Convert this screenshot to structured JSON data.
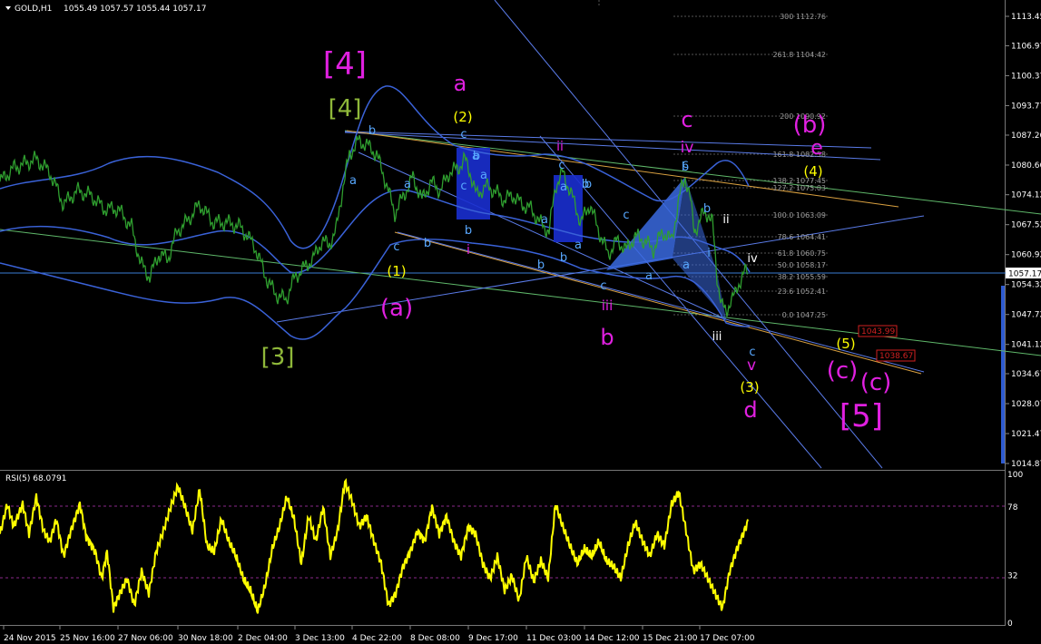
{
  "chart_data": {
    "type": "line",
    "header": {
      "symbol": "GOLD,H1",
      "ohlc": [
        "1055.49",
        "1057.57",
        "1055.44",
        "1057.17"
      ]
    },
    "price_axis": {
      "labels": [
        "1113.45",
        "1106.97",
        "1100.37",
        "1093.77",
        "1087.26",
        "1080.66",
        "1074.12",
        "1067.52",
        "1060.92",
        "1054.32",
        "1047.72",
        "1041.12",
        "1034.67",
        "1028.07",
        "1021.47",
        "1014.87"
      ],
      "current_price": "1057.17",
      "ylim": [
        1014.87,
        1113.45
      ]
    },
    "time_axis": {
      "labels": [
        "24 Nov 2015",
        "25 Nov 16:00",
        "27 Nov 06:00",
        "30 Nov 18:00",
        "2 Dec 04:00",
        "3 Dec 13:00",
        "4 Dec 22:00",
        "8 Dec 08:00",
        "9 Dec 17:00",
        "11 Dec 03:00",
        "14 Dec 12:00",
        "15 Dec 21:00",
        "17 Dec 07:00"
      ]
    },
    "price_series": {
      "name": "GOLD,H1",
      "color": "#2f9e2f",
      "anchors": [
        [
          0,
          1077
        ],
        [
          15,
          1080
        ],
        [
          40,
          1082
        ],
        [
          55,
          1079
        ],
        [
          70,
          1072
        ],
        [
          85,
          1075
        ],
        [
          100,
          1074
        ],
        [
          115,
          1071
        ],
        [
          130,
          1071
        ],
        [
          145,
          1067
        ],
        [
          155,
          1059
        ],
        [
          165,
          1056
        ],
        [
          175,
          1061
        ],
        [
          185,
          1060
        ],
        [
          195,
          1066
        ],
        [
          205,
          1068
        ],
        [
          220,
          1072
        ],
        [
          235,
          1068
        ],
        [
          250,
          1068
        ],
        [
          265,
          1067
        ],
        [
          280,
          1063
        ],
        [
          295,
          1055
        ],
        [
          305,
          1052
        ],
        [
          315,
          1051
        ],
        [
          325,
          1056
        ],
        [
          335,
          1058
        ],
        [
          345,
          1060
        ],
        [
          355,
          1064
        ],
        [
          362,
          1063
        ],
        [
          370,
          1066
        ],
        [
          378,
          1076
        ],
        [
          385,
          1083
        ],
        [
          395,
          1086
        ],
        [
          405,
          1085
        ],
        [
          415,
          1083
        ],
        [
          425,
          1077
        ],
        [
          435,
          1070
        ],
        [
          445,
          1074
        ],
        [
          455,
          1078
        ],
        [
          465,
          1073
        ],
        [
          475,
          1077
        ],
        [
          485,
          1075
        ],
        [
          495,
          1079
        ],
        [
          505,
          1080
        ],
        [
          512,
          1082
        ],
        [
          518,
          1079
        ],
        [
          525,
          1074
        ],
        [
          535,
          1076
        ],
        [
          545,
          1075
        ],
        [
          555,
          1073
        ],
        [
          565,
          1074
        ],
        [
          575,
          1072
        ],
        [
          585,
          1071
        ],
        [
          595,
          1068
        ],
        [
          605,
          1066
        ],
        [
          612,
          1076
        ],
        [
          620,
          1079
        ],
        [
          630,
          1074
        ],
        [
          640,
          1068
        ],
        [
          650,
          1072
        ],
        [
          660,
          1066
        ],
        [
          670,
          1061
        ],
        [
          680,
          1064
        ],
        [
          690,
          1062
        ],
        [
          700,
          1065
        ],
        [
          710,
          1064
        ],
        [
          720,
          1062
        ],
        [
          730,
          1066
        ],
        [
          740,
          1064
        ],
        [
          750,
          1075
        ],
        [
          755,
          1078
        ],
        [
          760,
          1074
        ],
        [
          765,
          1066
        ],
        [
          770,
          1068
        ],
        [
          775,
          1070
        ],
        [
          780,
          1070
        ],
        [
          785,
          1068
        ],
        [
          790,
          1056
        ],
        [
          795,
          1050
        ],
        [
          800,
          1048
        ],
        [
          805,
          1051
        ],
        [
          810,
          1052
        ],
        [
          815,
          1055
        ],
        [
          820,
          1057
        ],
        [
          824,
          1057
        ]
      ]
    },
    "rsi": {
      "label": "RSI(5) 68.0791",
      "color": "#ffff00",
      "levels": [
        78,
        32
      ],
      "axis_labels": [
        "100",
        "78",
        "32",
        "0"
      ],
      "anchors": [
        [
          0,
          60
        ],
        [
          8,
          80
        ],
        [
          15,
          65
        ],
        [
          25,
          80
        ],
        [
          32,
          60
        ],
        [
          40,
          85
        ],
        [
          48,
          62
        ],
        [
          55,
          55
        ],
        [
          62,
          70
        ],
        [
          70,
          45
        ],
        [
          78,
          62
        ],
        [
          88,
          80
        ],
        [
          95,
          58
        ],
        [
          105,
          48
        ],
        [
          112,
          30
        ],
        [
          118,
          48
        ],
        [
          125,
          10
        ],
        [
          132,
          20
        ],
        [
          140,
          30
        ],
        [
          148,
          12
        ],
        [
          156,
          35
        ],
        [
          164,
          20
        ],
        [
          172,
          48
        ],
        [
          180,
          62
        ],
        [
          188,
          78
        ],
        [
          196,
          92
        ],
        [
          204,
          78
        ],
        [
          212,
          62
        ],
        [
          220,
          90
        ],
        [
          228,
          52
        ],
        [
          236,
          48
        ],
        [
          244,
          70
        ],
        [
          252,
          55
        ],
        [
          260,
          45
        ],
        [
          268,
          30
        ],
        [
          276,
          22
        ],
        [
          284,
          8
        ],
        [
          292,
          25
        ],
        [
          300,
          50
        ],
        [
          308,
          65
        ],
        [
          316,
          85
        ],
        [
          324,
          70
        ],
        [
          332,
          40
        ],
        [
          340,
          72
        ],
        [
          348,
          55
        ],
        [
          356,
          78
        ],
        [
          364,
          45
        ],
        [
          372,
          62
        ],
        [
          380,
          95
        ],
        [
          388,
          82
        ],
        [
          396,
          65
        ],
        [
          404,
          72
        ],
        [
          412,
          55
        ],
        [
          420,
          40
        ],
        [
          428,
          12
        ],
        [
          436,
          20
        ],
        [
          444,
          38
        ],
        [
          452,
          48
        ],
        [
          460,
          62
        ],
        [
          468,
          55
        ],
        [
          476,
          78
        ],
        [
          484,
          60
        ],
        [
          492,
          72
        ],
        [
          500,
          55
        ],
        [
          508,
          45
        ],
        [
          516,
          65
        ],
        [
          524,
          60
        ],
        [
          532,
          40
        ],
        [
          540,
          30
        ],
        [
          548,
          45
        ],
        [
          556,
          22
        ],
        [
          564,
          32
        ],
        [
          572,
          15
        ],
        [
          580,
          45
        ],
        [
          588,
          28
        ],
        [
          596,
          42
        ],
        [
          604,
          30
        ],
        [
          612,
          80
        ],
        [
          620,
          65
        ],
        [
          628,
          52
        ],
        [
          636,
          40
        ],
        [
          644,
          50
        ],
        [
          652,
          45
        ],
        [
          660,
          55
        ],
        [
          668,
          42
        ],
        [
          676,
          38
        ],
        [
          684,
          30
        ],
        [
          692,
          52
        ],
        [
          700,
          68
        ],
        [
          708,
          55
        ],
        [
          716,
          45
        ],
        [
          724,
          60
        ],
        [
          732,
          52
        ],
        [
          740,
          80
        ],
        [
          748,
          88
        ],
        [
          756,
          62
        ],
        [
          764,
          35
        ],
        [
          772,
          40
        ],
        [
          780,
          30
        ],
        [
          788,
          20
        ],
        [
          796,
          10
        ],
        [
          804,
          35
        ],
        [
          812,
          50
        ],
        [
          820,
          62
        ],
        [
          824,
          68
        ]
      ]
    },
    "fibonacci": [
      {
        "ratio": "300",
        "price": "1112.76"
      },
      {
        "ratio": "261.8",
        "price": "1104.42"
      },
      {
        "ratio": "200",
        "price": "1090.92"
      },
      {
        "ratio": "161.8",
        "price": "1082.58"
      },
      {
        "ratio": "138.2",
        "price": "1077.45"
      },
      {
        "ratio": "127.2",
        "price": "1075.03"
      },
      {
        "ratio": "100.0",
        "price": "1063.09"
      },
      {
        "ratio": "78.6",
        "price": "1064.41"
      },
      {
        "ratio": "61.8",
        "price": "1060.75"
      },
      {
        "ratio": "50.0",
        "price": "1058.17"
      },
      {
        "ratio": "38.2",
        "price": "1055.59"
      },
      {
        "ratio": "23.6",
        "price": "1052.41"
      },
      {
        "ratio": "0.0",
        "price": "1047.25"
      }
    ],
    "price_tags": [
      "1043.99",
      "1038.67"
    ],
    "wave_labels": [
      {
        "text": "[4]",
        "color": "#e020e0"
      },
      {
        "text": "[4]",
        "color": "#8fb83a"
      },
      {
        "text": "[3]",
        "color": "#8fb83a"
      },
      {
        "text": "a",
        "color": "#e020e0"
      },
      {
        "text": "(2)",
        "color": "#ffff00"
      },
      {
        "text": "(1)",
        "color": "#ffff00"
      },
      {
        "text": "(a)",
        "color": "#e020e0"
      },
      {
        "text": "b",
        "color": "#e020e0"
      },
      {
        "text": "iii",
        "color": "#e020e0"
      },
      {
        "text": "c",
        "color": "#e020e0"
      },
      {
        "text": "iv",
        "color": "#e020e0"
      },
      {
        "text": "ii",
        "color": "#e020e0"
      },
      {
        "text": "i",
        "color": "#e020e0"
      },
      {
        "text": "(b)",
        "color": "#e020e0"
      },
      {
        "text": "e",
        "color": "#e020e0"
      },
      {
        "text": "(4)",
        "color": "#ffff00"
      },
      {
        "text": "(5)",
        "color": "#ffff00"
      },
      {
        "text": "(3)",
        "color": "#ffff00"
      },
      {
        "text": "d",
        "color": "#e020e0"
      },
      {
        "text": "v",
        "color": "#e020e0"
      },
      {
        "text": "(c)",
        "color": "#e020e0"
      },
      {
        "text": "(c)",
        "color": "#e020e0"
      },
      {
        "text": "[5]",
        "color": "#e020e0"
      },
      {
        "text": "ii",
        "color": "#ffffff"
      },
      {
        "text": "iv",
        "color": "#ffffff"
      },
      {
        "text": "iii",
        "color": "#ffffff"
      },
      {
        "text": "a",
        "color": "#58a8ff"
      },
      {
        "text": "b",
        "color": "#58a8ff"
      },
      {
        "text": "c",
        "color": "#58a8ff"
      },
      {
        "text": "a",
        "color": "#58a8ff"
      },
      {
        "text": "b",
        "color": "#58a8ff"
      },
      {
        "text": "c",
        "color": "#58a8ff"
      },
      {
        "text": "a",
        "color": "#58a8ff"
      },
      {
        "text": "b",
        "color": "#58a8ff"
      },
      {
        "text": "c",
        "color": "#58a8ff"
      },
      {
        "text": "b",
        "color": "#58a8ff"
      },
      {
        "text": "c",
        "color": "#58a8ff"
      },
      {
        "text": "a",
        "color": "#58a8ff"
      },
      {
        "text": "b",
        "color": "#58a8ff"
      },
      {
        "text": "c",
        "color": "#58a8ff"
      },
      {
        "text": "a",
        "color": "#58a8ff"
      },
      {
        "text": "b",
        "color": "#58a8ff"
      },
      {
        "text": "a",
        "color": "#58a8ff"
      },
      {
        "text": "b",
        "color": "#58a8ff"
      },
      {
        "text": "c",
        "color": "#58a8ff"
      },
      {
        "text": "a",
        "color": "#58a8ff"
      },
      {
        "text": "b",
        "color": "#58a8ff"
      },
      {
        "text": "a",
        "color": "#58a8ff"
      },
      {
        "text": "b",
        "color": "#58a8ff"
      },
      {
        "text": "c",
        "color": "#58a8ff"
      },
      {
        "text": "a",
        "color": "#58a8ff"
      },
      {
        "text": "b",
        "color": "#58a8ff"
      },
      {
        "text": "i",
        "color": "#58a8ff"
      },
      {
        "text": "c",
        "color": "#58a8ff"
      }
    ],
    "colors": {
      "background": "#000000",
      "price": "#2f9e2f",
      "bands": "#3a62d8",
      "rsi": "#ffff00",
      "magenta": "#e020e0",
      "yellow": "#ffff00",
      "olive": "#8fb83a",
      "wave_blue": "#58a8ff"
    }
  }
}
